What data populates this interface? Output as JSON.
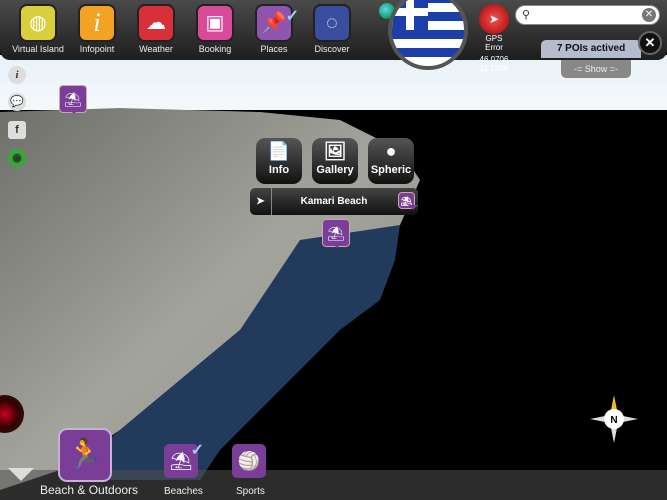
{
  "toolbar": {
    "apps": [
      {
        "label": "Virtual Island",
        "icon": "globe-icon",
        "color": "#d9cf3c"
      },
      {
        "label": "Infopoint",
        "icon": "info-icon",
        "color": "#f3a323"
      },
      {
        "label": "Weather",
        "icon": "cloud-icon",
        "color": "#d8303a"
      },
      {
        "label": "Booking",
        "icon": "suitcase-icon",
        "color": "#d94a9a"
      },
      {
        "label": "Places",
        "icon": "pushpin-icon",
        "color": "#8d55b0",
        "checked": true
      },
      {
        "label": "Discover",
        "icon": "compass-icon",
        "color": "#3a4ea0"
      }
    ]
  },
  "gps": {
    "label": "GPS Error",
    "lat": "46.0706",
    "lon": "11.1509"
  },
  "search": {
    "value": "",
    "placeholder": ""
  },
  "pois": {
    "label": "7 POIs actived",
    "show": "-= Show =-"
  },
  "popup": {
    "actions": [
      "Info",
      "Gallery",
      "Spheric"
    ],
    "place": "Kamari Beach"
  },
  "category": {
    "label": "Beach & Outdoors",
    "subs": [
      {
        "label": "Beaches",
        "checked": true
      },
      {
        "label": "Sports"
      }
    ]
  },
  "compass": {
    "north": "N"
  }
}
